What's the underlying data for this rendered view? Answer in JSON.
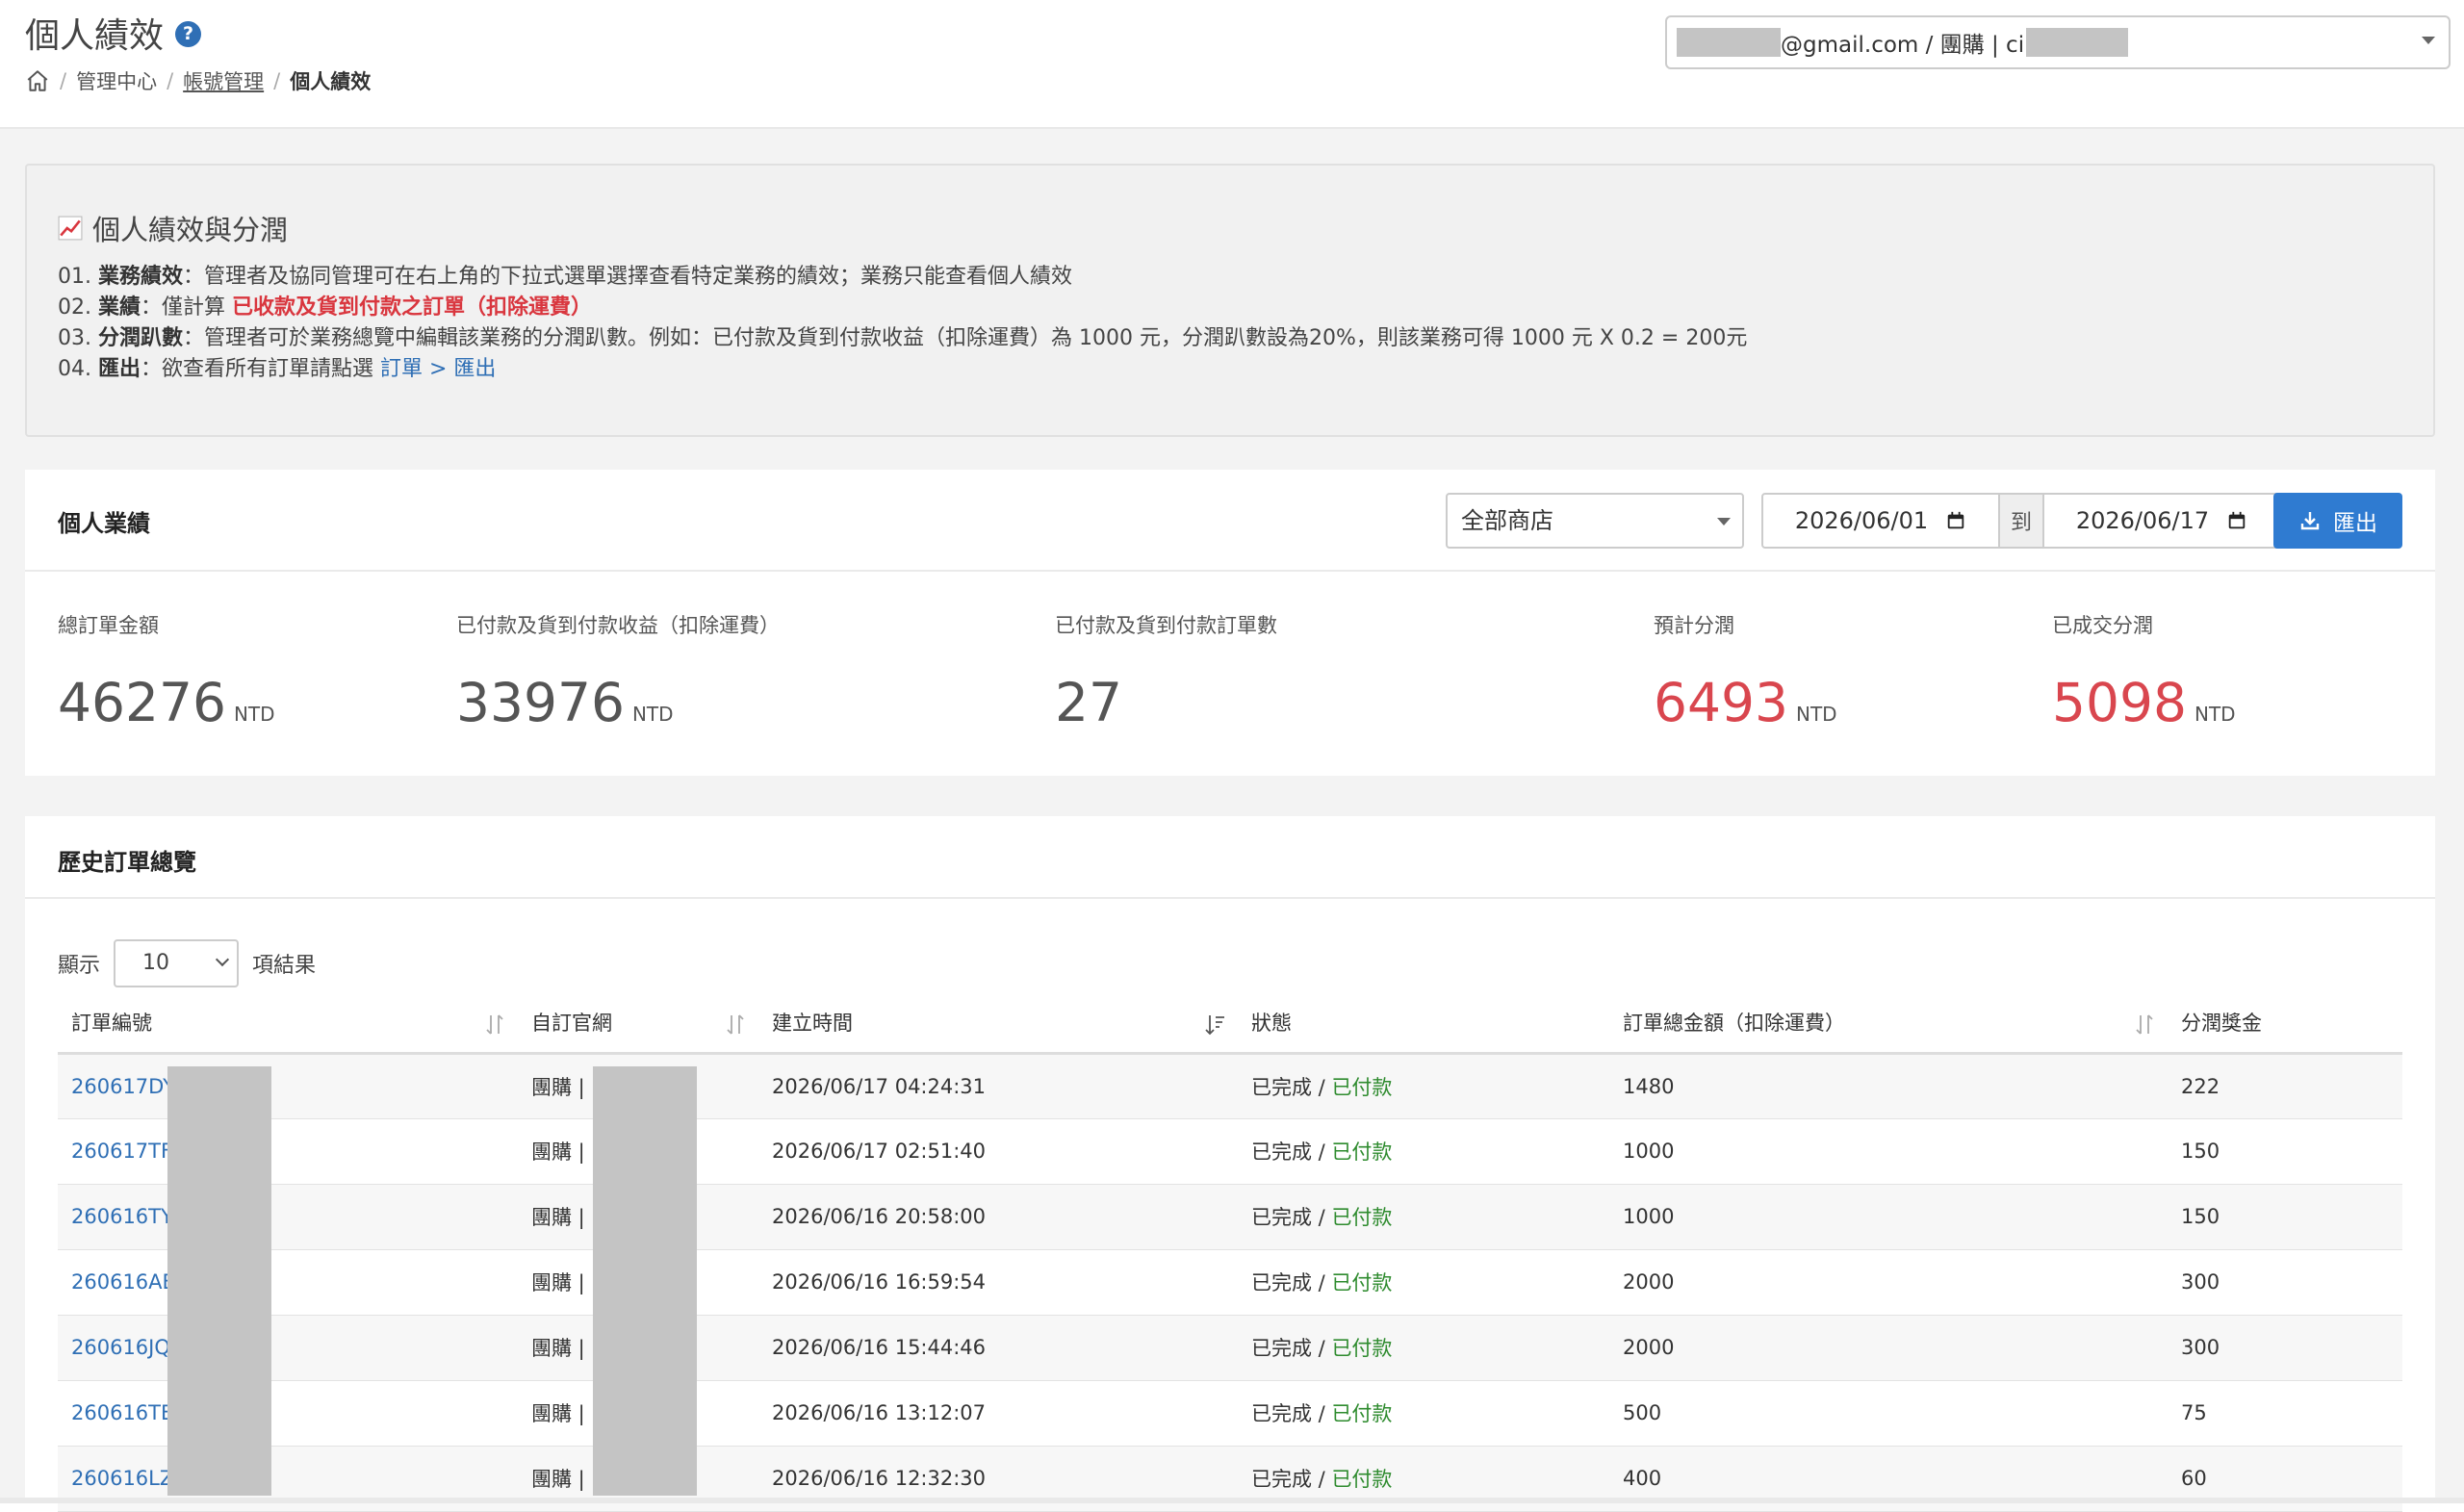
{
  "header": {
    "title": "個人績效",
    "help_label": "?",
    "breadcrumb": [
      "管理中心",
      "帳號管理",
      "個人績效"
    ],
    "account_selector": {
      "email_suffix": "@gmail.com / 團購 | ci"
    }
  },
  "info": {
    "title": "個人績效與分潤",
    "items": [
      {
        "num": "01.",
        "key": "業務績效",
        "text": "：管理者及協同管理可在右上角的下拉式選單選擇查看特定業務的績效；業務只能查看個人績效"
      },
      {
        "num": "02.",
        "key": "業績",
        "text": "：僅計算 ",
        "highlight": "已收款及貨到付款之訂單（扣除運費）"
      },
      {
        "num": "03.",
        "key": "分潤趴數",
        "text": "：管理者可於業務總覽中編輯該業務的分潤趴數。例如：已付款及貨到付款收益（扣除運費）為 1000 元，分潤趴數設為20%，則該業務可得 1000 元 X 0.2 = 200元"
      },
      {
        "num": "04.",
        "key": "匯出",
        "text": "：欲查看所有訂單請點選 ",
        "link": "訂單 > 匯出"
      }
    ]
  },
  "performance": {
    "title": "個人業績",
    "shop_select": "全部商店",
    "date_from": "2026/06/01",
    "date_sep": "到",
    "date_to": "2026/06/17",
    "export_label": "匯出",
    "stats": [
      {
        "label": "總訂單金額",
        "value": "46276",
        "unit": "NTD"
      },
      {
        "label": "已付款及貨到付款收益（扣除運費）",
        "value": "33976",
        "unit": "NTD"
      },
      {
        "label": "已付款及貨到付款訂單數",
        "value": "27",
        "unit": ""
      },
      {
        "label": "預計分潤",
        "value": "6493",
        "unit": "NTD"
      },
      {
        "label": "已成交分潤",
        "value": "5098",
        "unit": "NTD"
      }
    ]
  },
  "orders": {
    "title": "歷史訂單總覽",
    "show_label": "顯示",
    "page_length": "10",
    "results_label": "項結果",
    "columns": [
      "訂單編號",
      "自訂官網",
      "建立時間",
      "狀態",
      "訂單總金額（扣除運費）",
      "分潤獎金"
    ],
    "rows": [
      {
        "id": "260617DY",
        "site": "團購 |",
        "created": "2026/06/17 04:24:31",
        "status": "已完成 / ",
        "payment": "已付款",
        "amount": "1480",
        "bonus": "222"
      },
      {
        "id": "260617TF",
        "site": "團購 |",
        "created": "2026/06/17 02:51:40",
        "status": "已完成 / ",
        "payment": "已付款",
        "amount": "1000",
        "bonus": "150"
      },
      {
        "id": "260616TY",
        "site": "團購 |",
        "created": "2026/06/16 20:58:00",
        "status": "已完成 / ",
        "payment": "已付款",
        "amount": "1000",
        "bonus": "150"
      },
      {
        "id": "260616AE",
        "site": "團購 |",
        "created": "2026/06/16 16:59:54",
        "status": "已完成 / ",
        "payment": "已付款",
        "amount": "2000",
        "bonus": "300"
      },
      {
        "id": "260616JQ",
        "site": "團購 |",
        "created": "2026/06/16 15:44:46",
        "status": "已完成 / ",
        "payment": "已付款",
        "amount": "2000",
        "bonus": "300"
      },
      {
        "id": "260616TB",
        "site": "團購 |",
        "created": "2026/06/16 13:12:07",
        "status": "已完成 / ",
        "payment": "已付款",
        "amount": "500",
        "bonus": "75"
      },
      {
        "id": "260616LZ",
        "site": "團購 |",
        "created": "2026/06/16 12:32:30",
        "status": "已完成 / ",
        "payment": "已付款",
        "amount": "400",
        "bonus": "60"
      }
    ]
  },
  "colors": {
    "primary": "#2f7bd1",
    "link": "#2f6fb5",
    "highlight_red": "#d9363e",
    "paid_green": "#2e8b2e"
  }
}
